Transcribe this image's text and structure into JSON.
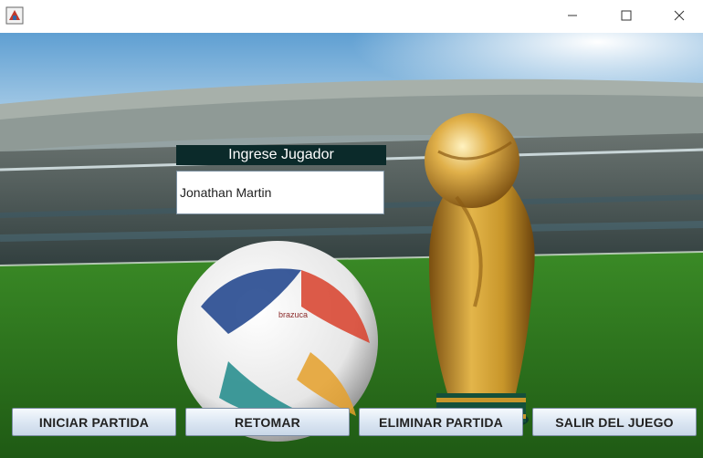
{
  "window": {
    "icons": {
      "app": "java-app-icon",
      "minimize": "minimize-icon",
      "maximize": "maximize-icon",
      "close": "close-icon"
    }
  },
  "form": {
    "label": "Ingrese Jugador",
    "player_name": "Jonathan Martin"
  },
  "buttons": {
    "start": "INICIAR PARTIDA",
    "resume": "RETOMAR",
    "delete": "ELIMINAR PARTIDA",
    "exit": "SALIR DEL JUEGO"
  },
  "background": {
    "ball_brand": "brazuca",
    "colors": {
      "sky": "#7fb6dd",
      "grass": "#2f7d22",
      "trophy_gold": "#c8962a",
      "label_bg": "#0b2a2a"
    }
  }
}
